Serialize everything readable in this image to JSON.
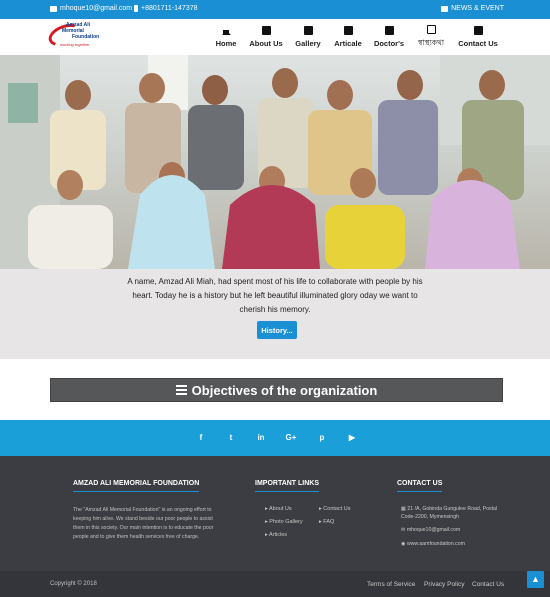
{
  "topbar": {
    "email": "mhoque10@gmail.com",
    "phone": "+8801711-147378",
    "news": "NEWS & EVENT"
  },
  "logo": {
    "line1": "Amzad Ali",
    "line2": "Memorial",
    "line3": "Foundation",
    "tagline": "working together"
  },
  "nav": [
    {
      "label": "Home",
      "icon": "home-icon"
    },
    {
      "label": "About Us",
      "icon": "document-icon"
    },
    {
      "label": "Gallery",
      "icon": "image-icon"
    },
    {
      "label": "Articale",
      "icon": "book-icon"
    },
    {
      "label": "Doctor's",
      "icon": "book-icon"
    },
    {
      "label": "স্বাস্থ্যকথা",
      "icon": "newspaper-icon"
    },
    {
      "label": "Contact Us",
      "icon": "contact-card-icon"
    }
  ],
  "intro": {
    "text": "A name, Amzad Ali Miah, had spent most of his life to collaborate with people by his heart. Today he is a history but he left beautiful illuminated glory oday we want to cherish his memory.",
    "button": "History..."
  },
  "objectives": {
    "title": "Objectives of the organization"
  },
  "social": [
    "f",
    "t",
    "in",
    "G+",
    "p",
    "▶"
  ],
  "footer": {
    "about_title": "AMZAD ALI MEMORIAL FOUNDATION",
    "about_text": "The \"Amzad Ali Memorial Foundation\" is an ongoing effort to keeping him alive. We stand beside our poor people to assist them in this society. Our main intention is to educate the poor people and to give them health services free of charge.",
    "links_title": "IMPORTANT LINKS",
    "links_col1": [
      "About Us",
      "Photo Gallery",
      "Articles"
    ],
    "links_col2": [
      "Contact Us",
      "FAQ"
    ],
    "contact_title": "CONTACT US",
    "address": "21 /A, Gobinda Gungulee Road, Postal Code-2200, Mymensingh",
    "email": "mhoque10@gmail.com",
    "website": "www.aamfoundation.com"
  },
  "bottom": {
    "copyright": "Copyright © 2018",
    "links": [
      "Terms of Service",
      "Privacy Policy",
      "Contact Us"
    ],
    "totop": "▲"
  },
  "colors": {
    "brand_blue": "#1a8fd3",
    "social_blue": "#1a9fd8",
    "footer_dark": "#3b3d42",
    "objectives_bg": "#555759",
    "logo_red": "#d71920"
  }
}
